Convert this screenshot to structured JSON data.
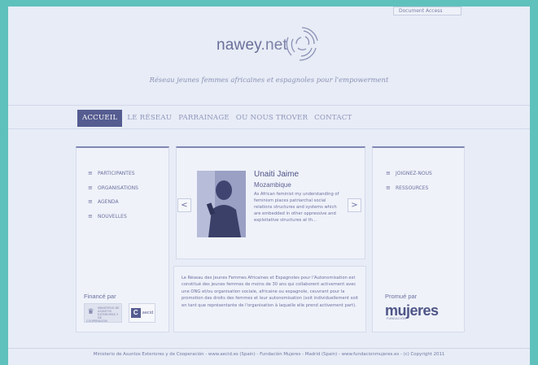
{
  "header": {
    "top_button": "Document Access",
    "logo_main": "nawey",
    "logo_suffix": ".net",
    "tagline": "Réseau jeunes femmes africaines et espagnoles pour l'empowerment"
  },
  "nav": {
    "items": [
      {
        "label": "ACCUEIL",
        "active": true
      },
      {
        "label": "LE RÉSEAU",
        "active": false
      },
      {
        "label": "PARRAINAGE",
        "active": false
      },
      {
        "label": "OU NOUS TROVER",
        "active": false
      },
      {
        "label": "CONTACT",
        "active": false
      }
    ]
  },
  "left_panel": {
    "menu": [
      "PARTICIPANTES",
      "ORGANISATIONS",
      "AGENDA",
      "NOUVELLES"
    ],
    "financed_label": "Financé par",
    "logo1_text": "MINISTERIO DE ASUNTOS EXTERIORES Y DE COOPERACIÓN",
    "logo2_text": "aecid",
    "logo2_letter": "C"
  },
  "right_panel": {
    "menu": [
      "JOIGNEZ-NOUS",
      "RESSOURCES"
    ],
    "promoted_label": "Promué par",
    "mujeres_logo": "mujeres",
    "fundacion_label": "FUNDACIÓN"
  },
  "featured": {
    "name": "Unaiti Jaime",
    "country": "Mozambique",
    "excerpt": "As African feminist my understanding of feminism places patriarchal social relations structures and systems which are embedded in other oppressive and exploitative structures at th...",
    "prev_arrow": "<",
    "next_arrow": ">"
  },
  "intro_text": "Le Réseau des Jeunes Femmes Africaines et Espagnoles pour l'Autonomisation est constitué des jeunes femmes de moins de 30 ans qui collaborent activement avec une ONG et/ou organisation sociale, africaine ou espagnole, ceuvrant pour la promotion des droits des femmes et leur autonomisation (soit individuellement soit en tant que représentante de l'organisation à laquelle elle prend activement part).",
  "footer": {
    "text": "Ministerio de Asuntos Exteriores y de Cooperación - www.aecid.es (Spain)  -  Fundación Mujeres - Madrid (Spain) - www.fundacionmujeres.es  -  (c) Copyright 2011"
  },
  "colors": {
    "background": "#5fc1bc",
    "page": "#e7ecf6",
    "accent": "#555c90"
  }
}
